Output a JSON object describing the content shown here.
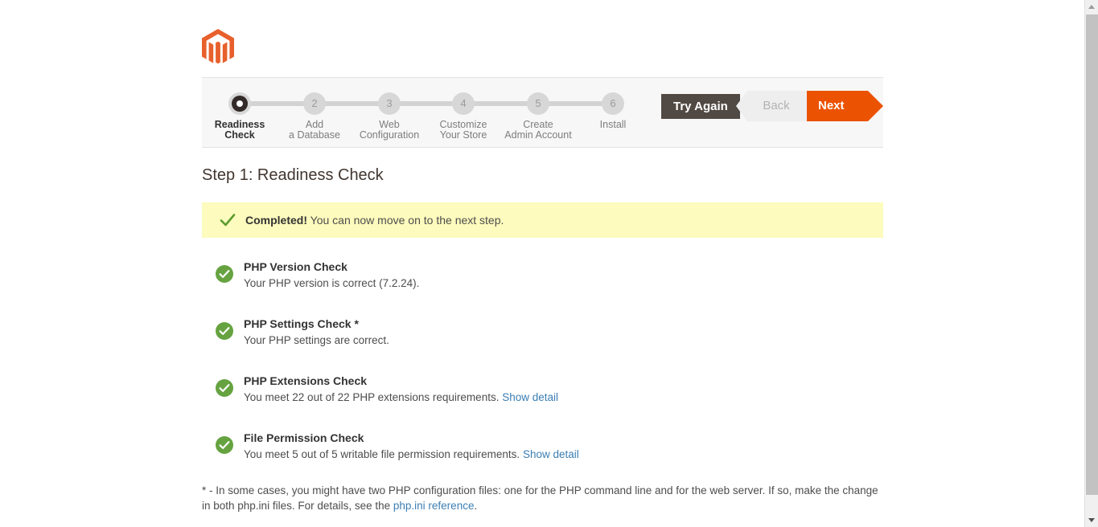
{
  "branding": {
    "logo_icon": "magento-logo-icon",
    "logo_color": "#e8602c"
  },
  "stepper": {
    "steps": [
      {
        "number": "1",
        "line1": "Readiness",
        "line2": "Check",
        "state": "active"
      },
      {
        "number": "2",
        "line1": "Add",
        "line2": "a Database",
        "state": "pending"
      },
      {
        "number": "3",
        "line1": "Web",
        "line2": "Configuration",
        "state": "pending"
      },
      {
        "number": "4",
        "line1": "Customize",
        "line2": "Your Store",
        "state": "pending"
      },
      {
        "number": "5",
        "line1": "Create",
        "line2": "Admin Account",
        "state": "pending"
      },
      {
        "number": "6",
        "line1": "Install",
        "line2": "",
        "state": "pending"
      }
    ]
  },
  "actions": {
    "try_again_label": "Try Again",
    "back_label": "Back",
    "next_label": "Next",
    "try_again_color": "#514943",
    "next_color": "#eb5202",
    "back_disabled": true
  },
  "page": {
    "title": "Step 1: Readiness Check"
  },
  "banner": {
    "icon": "check-mark-icon",
    "bold_text": "Completed!",
    "text": " You can now move on to the next step.",
    "background": "#fdfbbd",
    "icon_color": "#5c9c2e"
  },
  "checks": [
    {
      "status_icon": "check-circle-icon",
      "title": "PHP Version Check",
      "description": "Your PHP version is correct (7.2.24).",
      "link": ""
    },
    {
      "status_icon": "check-circle-icon",
      "title": "PHP Settings Check *",
      "description": "Your PHP settings are correct.",
      "link": ""
    },
    {
      "status_icon": "check-circle-icon",
      "title": "PHP Extensions Check",
      "description": "You meet 22 out of 22 PHP extensions requirements. ",
      "link": "Show detail"
    },
    {
      "status_icon": "check-circle-icon",
      "title": "File Permission Check",
      "description": "You meet 5 out of 5 writable file permission requirements. ",
      "link": "Show detail"
    }
  ],
  "footnote": {
    "text": "* - In some cases, you might have two PHP configuration files: one for the PHP command line and for the web server. If so, make the change in both php.ini files. For details, see the ",
    "link": "php.ini reference",
    "suffix": "."
  },
  "scrollbar": {
    "up_arrow": "scroll-up-arrow-icon",
    "down_arrow": "scroll-down-arrow-icon"
  },
  "colors": {
    "accent": "#eb5202",
    "success": "#5c9c2e",
    "link": "#3b7eb3"
  }
}
